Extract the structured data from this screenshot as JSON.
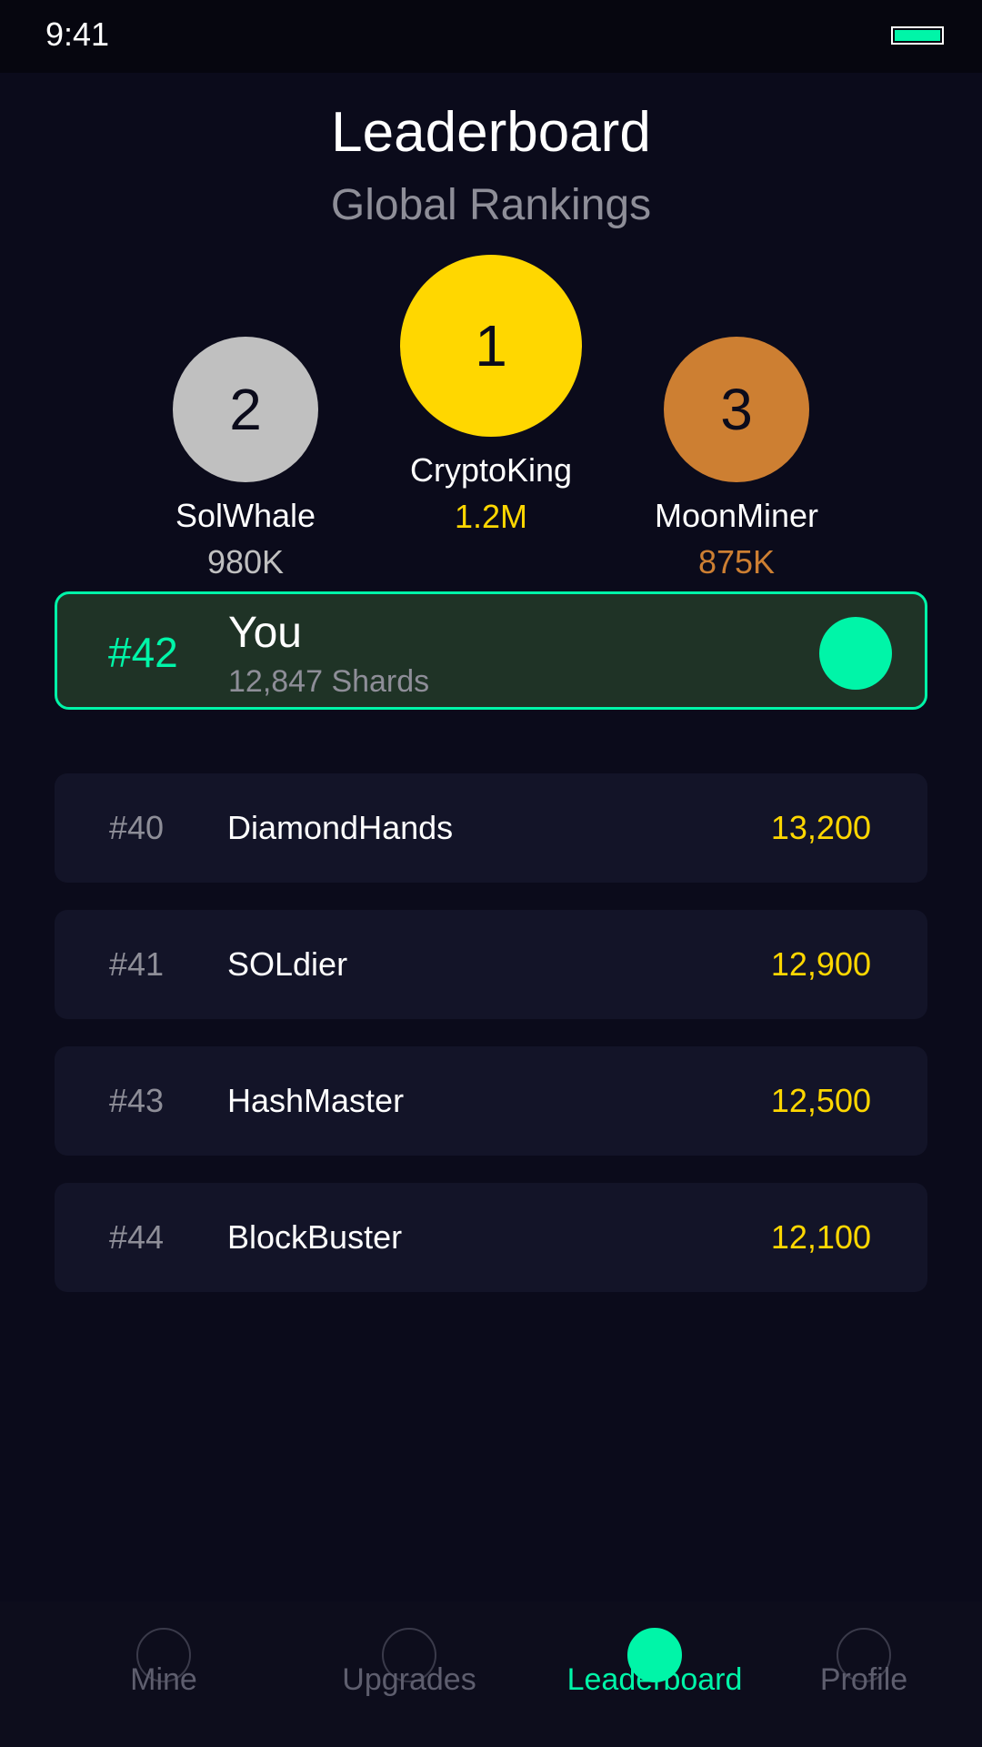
{
  "status_bar": {
    "time": "9:41",
    "battery_icon": "battery-icon",
    "battery_level": 1.0
  },
  "header": {
    "title": "Leaderboard",
    "subtitle": "Global Rankings"
  },
  "podium": {
    "first": {
      "rank": "1",
      "name": "CryptoKing",
      "score": "1.2M",
      "color": "#ffd700"
    },
    "second": {
      "rank": "2",
      "name": "SolWhale",
      "score": "980K",
      "color": "#c0c0c0"
    },
    "third": {
      "rank": "3",
      "name": "MoonMiner",
      "score": "875K",
      "color": "#cd7f32"
    }
  },
  "you": {
    "rank": "#42",
    "name": "You",
    "shards": "12,847 Shards",
    "avatar_color": "#00f5a8"
  },
  "rankings": [
    {
      "rank": "#40",
      "name": "DiamondHands",
      "score": "13,200"
    },
    {
      "rank": "#41",
      "name": "SOLdier",
      "score": "12,900"
    },
    {
      "rank": "#43",
      "name": "HashMaster",
      "score": "12,500"
    },
    {
      "rank": "#44",
      "name": "BlockBuster",
      "score": "12,100"
    }
  ],
  "nav": {
    "active": "Leaderboard",
    "items": [
      {
        "label": "Mine",
        "icon": "mine-icon"
      },
      {
        "label": "Upgrades",
        "icon": "upgrades-icon"
      },
      {
        "label": "Leaderboard",
        "icon": "leaderboard-icon"
      },
      {
        "label": "Profile",
        "icon": "profile-icon"
      }
    ]
  },
  "colors": {
    "background": "#0b0b1b",
    "accent": "#00f5a8",
    "gold": "#ffd700",
    "silver": "#c0c0c0",
    "bronze": "#cd7f32",
    "muted": "#8e8e98",
    "row_bg": "#131428",
    "you_card_bg": "#1f3326"
  }
}
